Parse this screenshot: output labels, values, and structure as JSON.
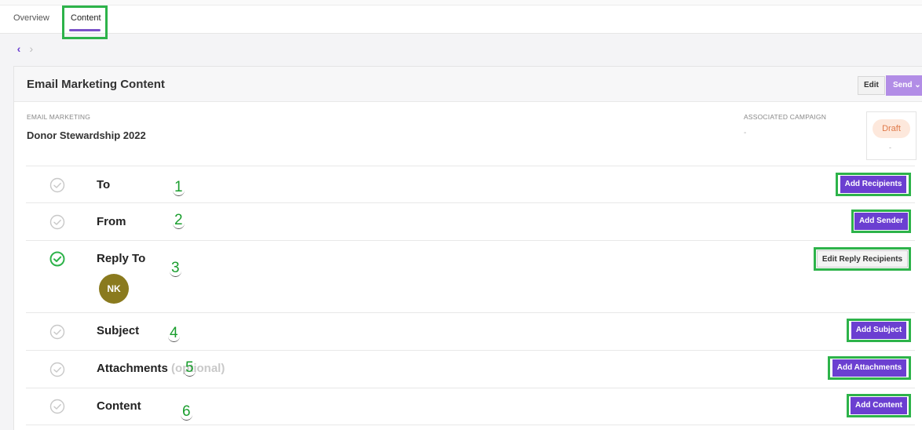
{
  "tabs": [
    {
      "label": "Overview",
      "active": false
    },
    {
      "label": "Content",
      "active": true
    }
  ],
  "pager": {
    "prev": "‹",
    "next": "›"
  },
  "card": {
    "title": "Email Marketing Content",
    "edit_label": "Edit",
    "send_label": "Send ⌄",
    "email_marketing_label": "EMAIL MARKETING",
    "email_marketing_value": "Donor Stewardship 2022",
    "campaign_label": "ASSOCIATED CAMPAIGN",
    "campaign_value": "-",
    "status": "Draft",
    "status_sub": "-"
  },
  "rows": [
    {
      "label": "To",
      "marker": "1",
      "done": false,
      "action": "Add Recipients"
    },
    {
      "label": "From",
      "marker": "2",
      "done": false,
      "action": "Add Sender"
    },
    {
      "label": "Reply To",
      "marker": "3",
      "done": true,
      "action": "Edit Reply Recipients",
      "avatar": "NK"
    },
    {
      "label": "Subject",
      "marker": "4",
      "done": false,
      "action": "Add Subject"
    },
    {
      "label": "Attachments",
      "optional": "(optional)",
      "marker": "5",
      "done": false,
      "action": "Add Attachments"
    },
    {
      "label": "Content",
      "marker": "6",
      "done": false,
      "action": "Add Content"
    }
  ],
  "colors": {
    "accent": "#6b3fd1",
    "highlight": "#2db34a",
    "done": "#2db34a",
    "pending": "#c8c8c8"
  },
  "icons": {
    "check": "check-circle-icon",
    "prev": "chevron-left-icon",
    "next": "chevron-right-icon"
  }
}
